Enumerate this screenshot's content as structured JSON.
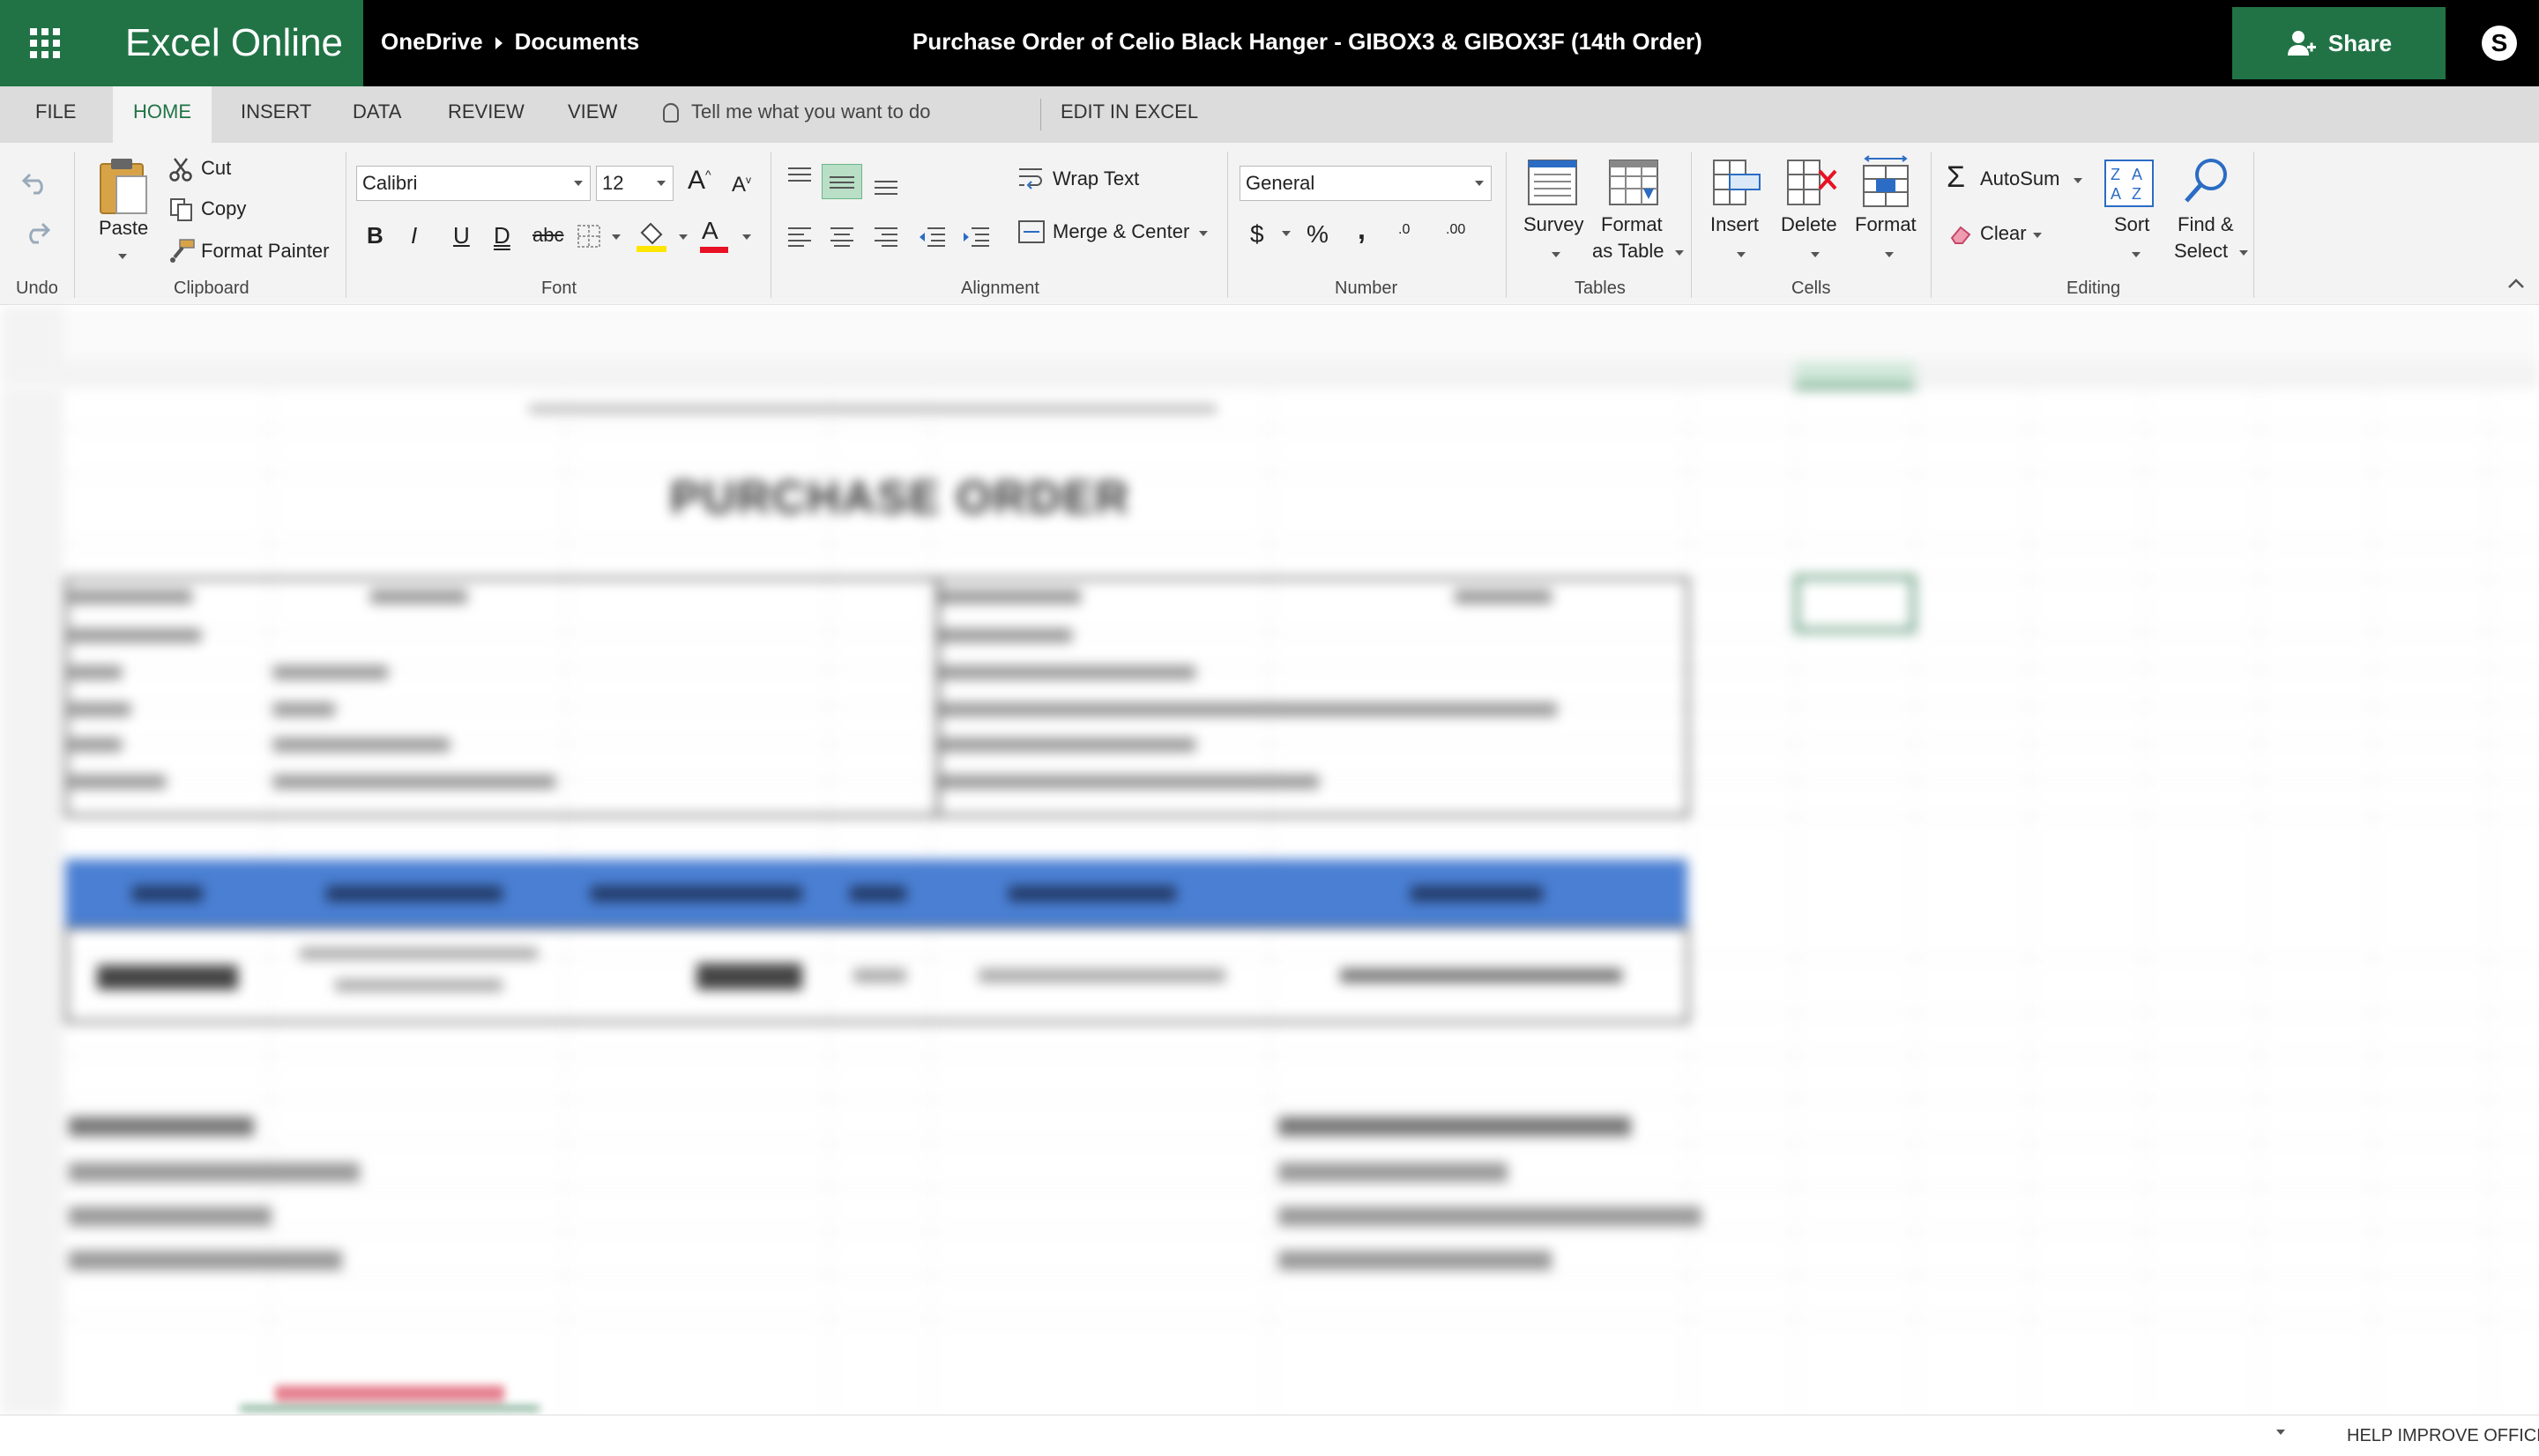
{
  "app": {
    "name": "Excel Online",
    "brand_color": "#217346"
  },
  "breadcrumb": {
    "location": "OneDrive",
    "folder": "Documents"
  },
  "document": {
    "title": "Purchase Order of Celio Black Hanger - GIBOX3 & GIBOX3F (14th Order)"
  },
  "share": {
    "label": "Share"
  },
  "tabs": [
    "FILE",
    "HOME",
    "INSERT",
    "DATA",
    "REVIEW",
    "VIEW"
  ],
  "active_tab": "HOME",
  "tell_me": {
    "placeholder": "Tell me what you want to do"
  },
  "edit_in_excel": "EDIT IN EXCEL",
  "ribbon": {
    "undo": {
      "label": "Undo"
    },
    "clipboard": {
      "label": "Clipboard",
      "paste": "Paste",
      "cut": "Cut",
      "copy": "Copy",
      "format_painter": "Format Painter"
    },
    "font": {
      "label": "Font",
      "family": "Calibri",
      "size": "12",
      "bold": "B",
      "italic": "I",
      "underline": "U",
      "double_underline": "D",
      "strike": "abc",
      "font_color_letter": "A"
    },
    "alignment": {
      "label": "Alignment",
      "wrap_text": "Wrap Text",
      "merge_center": "Merge & Center"
    },
    "number": {
      "label": "Number",
      "format": "General",
      "currency": "$",
      "percent": "%",
      "comma": ",",
      "inc_decimal": ".0",
      "dec_decimal": ".00"
    },
    "tables": {
      "label": "Tables",
      "survey": "Survey",
      "format_as_table_1": "Format",
      "format_as_table_2": "as Table"
    },
    "cells": {
      "label": "Cells",
      "insert": "Insert",
      "delete": "Delete",
      "format": "Format"
    },
    "editing": {
      "label": "Editing",
      "autosum": "AutoSum",
      "clear": "Clear",
      "sort": "Sort",
      "find_1": "Find &",
      "find_2": "Select"
    }
  },
  "sheet": {
    "title": "PURCHASE ORDER",
    "header_color": "#4a7fd3"
  },
  "status": {
    "help": "HELP IMPROVE OFFICE"
  }
}
